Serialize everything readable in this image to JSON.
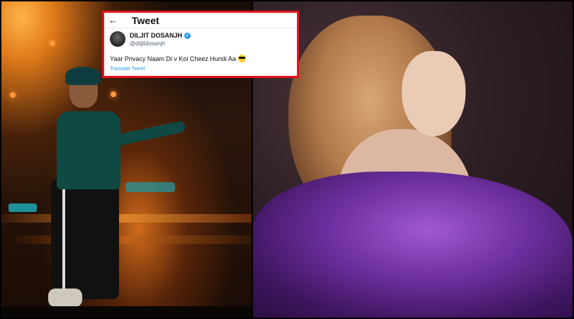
{
  "tweet": {
    "header_title": "Tweet",
    "back_icon": "←",
    "author_name": "DILJIT DOSANJH",
    "handle": "@diljitdosanjh",
    "verified_icon": "✓",
    "text": "Yaar Privacy Naam Di v Koi Cheez Hundi Aa",
    "emoji": "sunglasses-emoji",
    "translate_label": "Translate Tweet"
  },
  "colors": {
    "highlight_border": "#e3131b",
    "link_blue": "#1d9bf0"
  }
}
